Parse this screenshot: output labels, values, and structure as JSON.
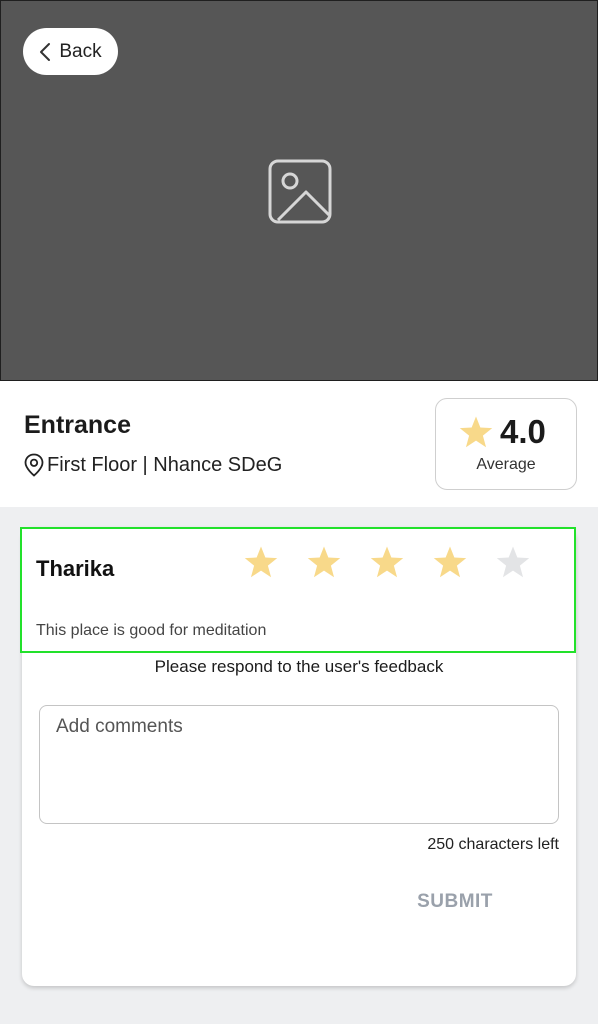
{
  "header": {
    "back_label": "Back",
    "back_icon": "chevron-left-icon",
    "image_icon": "image-placeholder-icon"
  },
  "place": {
    "name": "Entrance",
    "location": "First Floor | Nhance SDeG",
    "location_icon": "location-pin-icon"
  },
  "rating_summary": {
    "value": "4.0",
    "label": "Average",
    "star_color": "#f8d98a"
  },
  "review": {
    "reviewer": "Tharika",
    "rating": 4,
    "max_rating": 5,
    "text": "This place is good for meditation",
    "highlight_color": "#22e12b"
  },
  "response": {
    "prompt": "Please respond to the user's feedback",
    "comment_placeholder": "Add comments",
    "comment_value": "",
    "chars_left": "250 characters left",
    "submit_label": "SUBMIT"
  },
  "colors": {
    "star_filled": "#f8d98a",
    "star_empty": "#e3e4e6",
    "hero_bg": "#565656",
    "page_bg": "#eeeff1",
    "submit_disabled": "#9aa1ab"
  }
}
